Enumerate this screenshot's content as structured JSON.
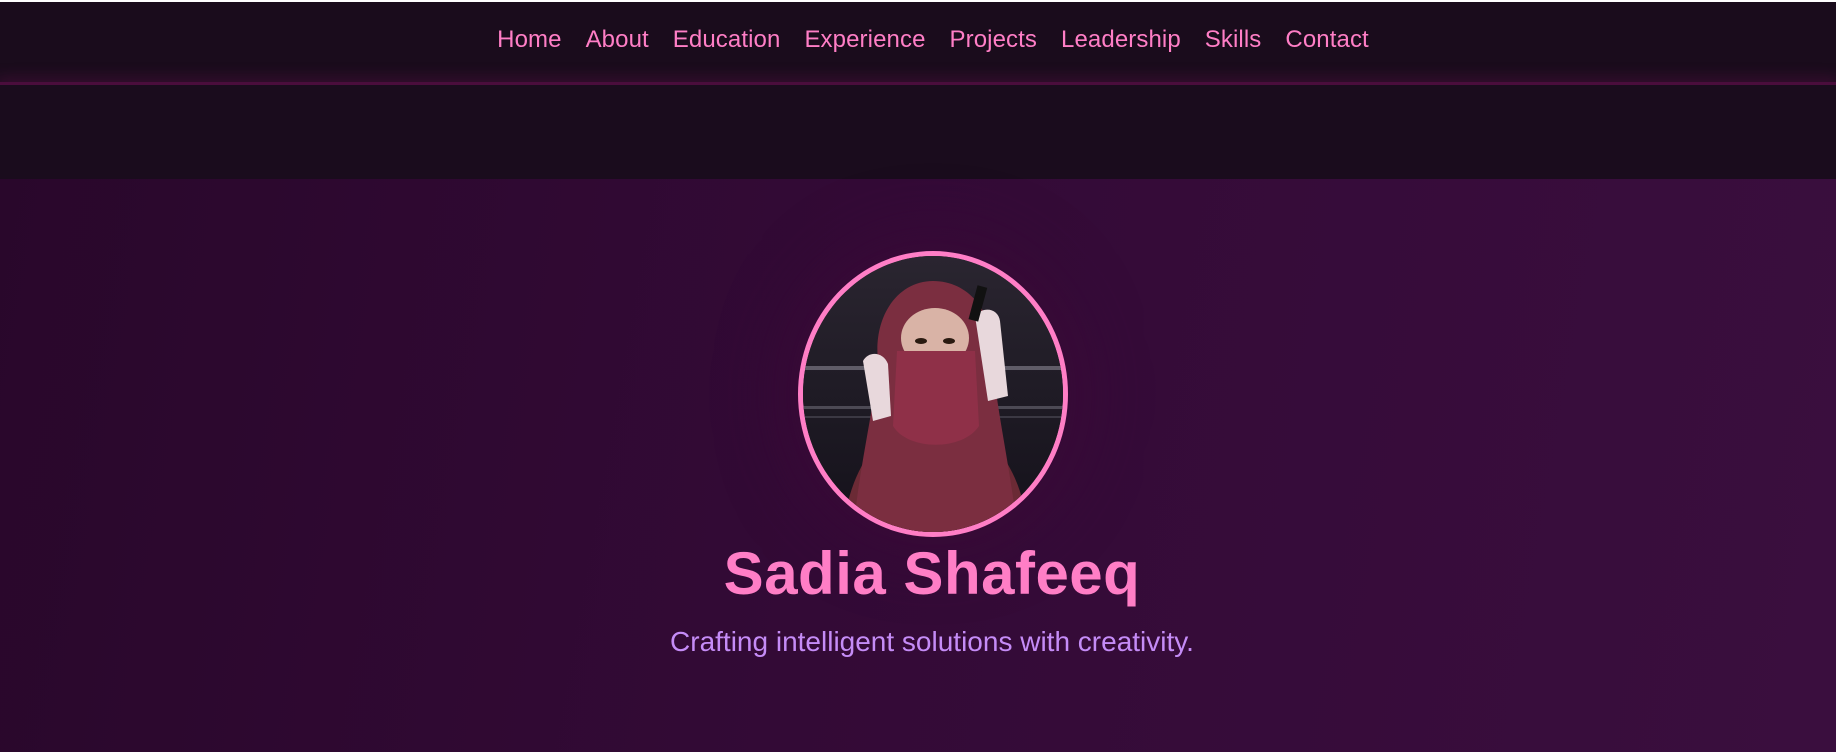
{
  "nav": {
    "items": [
      {
        "label": "Home"
      },
      {
        "label": "About"
      },
      {
        "label": "Education"
      },
      {
        "label": "Experience"
      },
      {
        "label": "Projects"
      },
      {
        "label": "Leadership"
      },
      {
        "label": "Skills"
      },
      {
        "label": "Contact"
      }
    ]
  },
  "hero": {
    "name": "Sadia Shafeeq",
    "tagline": "Crafting intelligent solutions with creativity.",
    "photo_icon": "profile-photo"
  },
  "colors": {
    "accent": "#ff7ec6",
    "tagline": "#c58cf7",
    "nav_bg": "#1a0c1c",
    "hero_bg": "#330a36"
  }
}
